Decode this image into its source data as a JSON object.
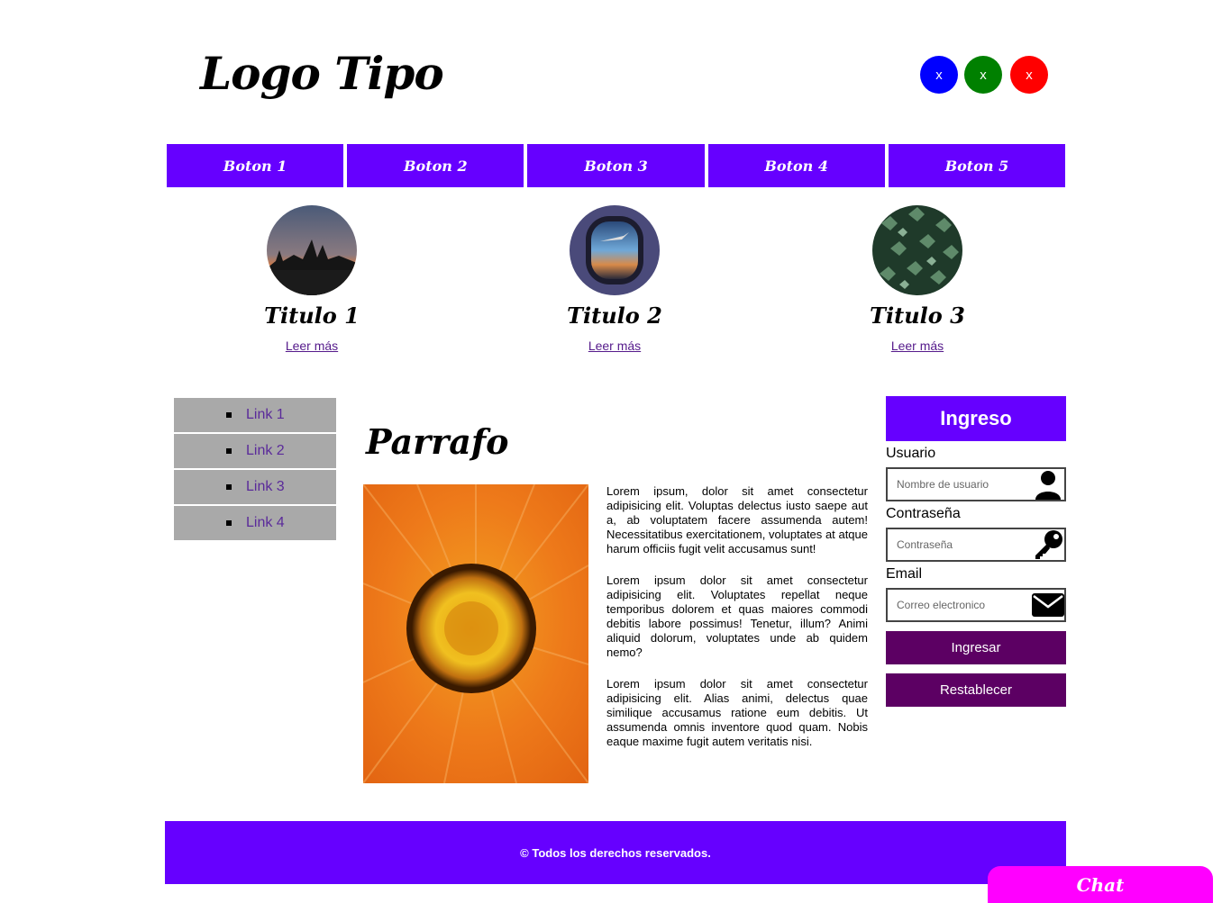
{
  "header": {
    "logo": "Logo Tipo",
    "social": [
      {
        "label": "x",
        "color": "#0000ff"
      },
      {
        "label": "x",
        "color": "#008000"
      },
      {
        "label": "x",
        "color": "#ff0000"
      }
    ]
  },
  "nav": [
    "Boton 1",
    "Boton 2",
    "Boton 3",
    "Boton 4",
    "Boton 5"
  ],
  "cards": [
    {
      "title": "Titulo 1",
      "link": "Leer más"
    },
    {
      "title": "Titulo 2",
      "link": "Leer más"
    },
    {
      "title": "Titulo 3",
      "link": "Leer más"
    }
  ],
  "sidebar": [
    "Link 1",
    "Link 2",
    "Link 3",
    "Link 4"
  ],
  "main": {
    "title": "Parrafo",
    "paragraphs": [
      "Lorem ipsum, dolor sit amet consectetur adipisicing elit. Voluptas delectus iusto saepe aut a, ab voluptatem facere assumenda autem! Necessitatibus exercitationem, voluptates at atque harum officiis fugit velit accusamus sunt!",
      "Lorem ipsum dolor sit amet consectetur adipisicing elit. Voluptates repellat neque temporibus dolorem et quas maiores commodi debitis labore possimus! Tenetur, illum? Animi aliquid dolorum, voluptates unde ab quidem nemo?",
      "Lorem ipsum dolor sit amet consectetur adipisicing elit. Alias animi, delectus quae similique accusamus ratione eum debitis. Ut assumenda omnis inventore quod quam. Nobis eaque maxime fugit autem veritatis nisi."
    ]
  },
  "login": {
    "title": "Ingreso",
    "user_label": "Usuario",
    "user_placeholder": "Nombre de usuario",
    "pass_label": "Contraseña",
    "pass_placeholder": "Contraseña",
    "email_label": "Email",
    "email_placeholder": "Correo electronico",
    "submit": "Ingresar",
    "reset": "Restablecer"
  },
  "footer": "© Todos los derechos reservados.",
  "chat": "Chat",
  "colors": {
    "primary": "#6600ff",
    "button": "#5c0063",
    "chat": "#ff00ff"
  }
}
